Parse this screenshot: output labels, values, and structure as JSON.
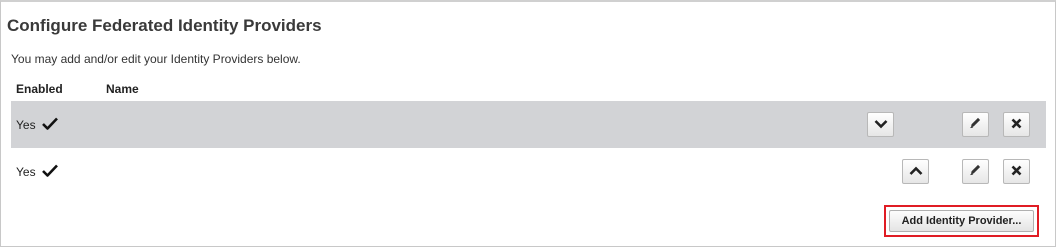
{
  "page": {
    "title": "Configure Federated Identity Providers",
    "description": "You may add and/or edit your Identity Providers below."
  },
  "table": {
    "columns": {
      "enabled": "Enabled",
      "name": "Name"
    },
    "rows": [
      {
        "enabled": "Yes",
        "name": "",
        "selected": true,
        "move_icon": "chevron-down-icon"
      },
      {
        "enabled": "Yes",
        "name": "",
        "selected": false,
        "move_icon": "chevron-up-icon"
      }
    ]
  },
  "actions": {
    "add_label": "Add Identity Provider..."
  },
  "colors": {
    "selected_row": "#d2d3d6",
    "highlight_border": "#e01c24"
  }
}
